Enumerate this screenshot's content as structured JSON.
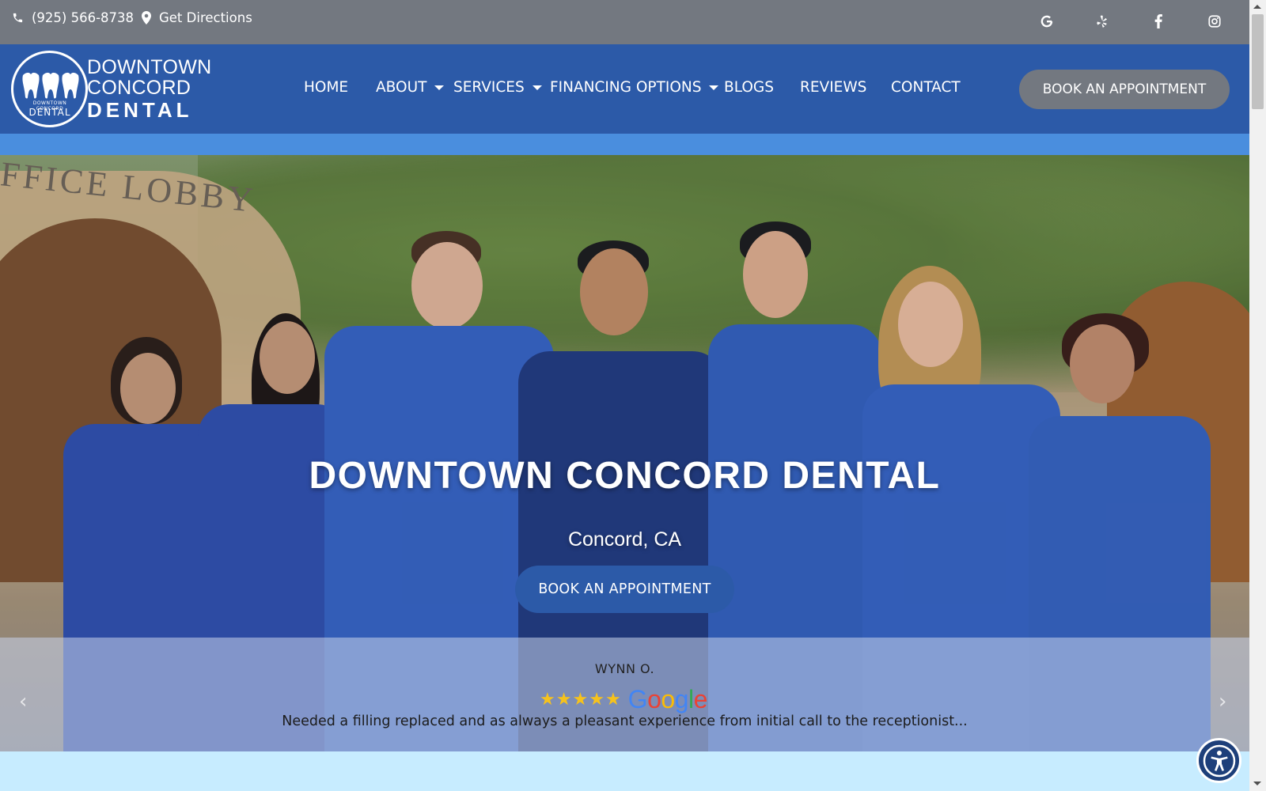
{
  "topbar": {
    "phone": "(925) 566-8738",
    "directions": "Get Directions",
    "social": [
      "google-icon",
      "yelp-icon",
      "facebook-icon",
      "instagram-icon"
    ]
  },
  "logo": {
    "line1": "DOWNTOWN",
    "line2": "CONCORD",
    "line3": "DENTAL",
    "badge_small": "DOWNTOWN CONCORD",
    "badge_big": "DENTAL"
  },
  "nav": {
    "items": [
      {
        "label": "HOME"
      },
      {
        "label": "ABOUT"
      },
      {
        "label": "SERVICES"
      },
      {
        "label": "FINANCING OPTIONS"
      },
      {
        "label": "BLOGS"
      },
      {
        "label": "REVIEWS"
      },
      {
        "label": "CONTACT"
      }
    ],
    "book_label": "BOOK AN APPOINTMENT"
  },
  "hero": {
    "title": "DOWNTOWN CONCORD DENTAL",
    "subtitle": "Concord, CA",
    "button_label": "BOOK AN APPOINTMENT",
    "sign_text": "FFICE LOBBY"
  },
  "review": {
    "name": "WYNN O.",
    "rating": 5,
    "source": "Google",
    "text": "Needed a filling replaced and as always a pleasant experience from initial call to the receptionist..."
  },
  "colors": {
    "topbar": "#737880",
    "navbar": "#2c5aa8",
    "strip": "#4a8ede",
    "accent_button": "#2c5aa8",
    "star": "#f6c21c"
  }
}
